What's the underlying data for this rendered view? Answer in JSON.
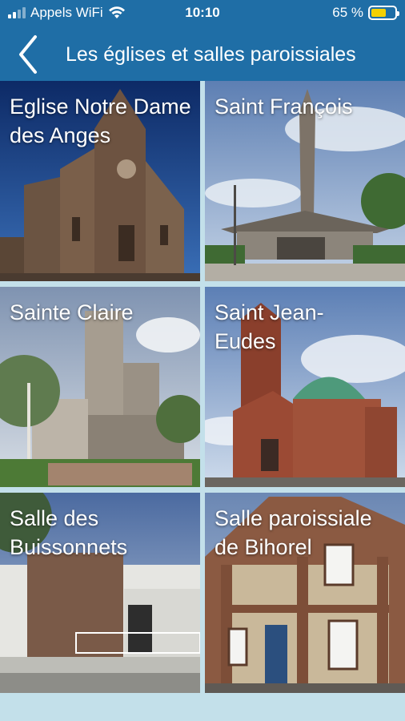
{
  "status": {
    "carrier": "Appels WiFi",
    "time": "10:10",
    "battery": "65 %"
  },
  "header": {
    "title": "Les églises et salles paroissiales"
  },
  "tiles": [
    {
      "name": "Eglise Notre Dame des Anges"
    },
    {
      "name": "Saint François"
    },
    {
      "name": "Sainte Claire"
    },
    {
      "name": "Saint Jean-Eudes"
    },
    {
      "name": "Salle des Buissonnets"
    },
    {
      "name": "Salle paroissiale de Bihorel"
    }
  ],
  "icons": [
    "back-chevron-icon",
    "wifi-icon",
    "signal-icon",
    "battery-icon"
  ]
}
